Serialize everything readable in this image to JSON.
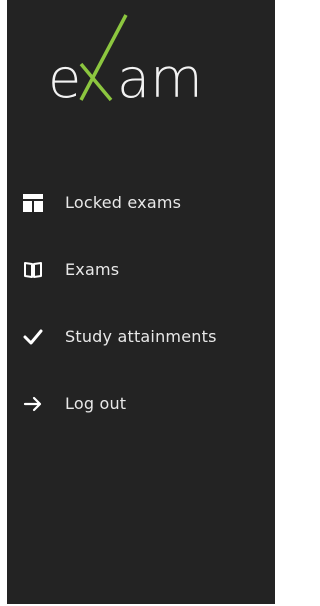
{
  "brand": {
    "logo_text": "exam",
    "accent_color": "#8cc63f"
  },
  "sidebar": {
    "items": [
      {
        "label": "Locked exams",
        "icon": "layout-icon"
      },
      {
        "label": "Exams",
        "icon": "book-icon"
      },
      {
        "label": "Study attainments",
        "icon": "checkmark-icon"
      },
      {
        "label": "Log out",
        "icon": "arrow-right-icon"
      }
    ]
  }
}
